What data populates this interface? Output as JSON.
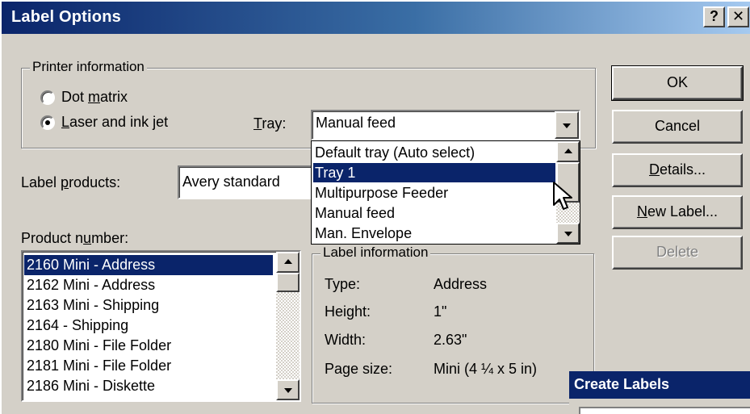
{
  "window": {
    "title": "Label Options",
    "help_glyph": "?",
    "close_glyph": "✕"
  },
  "printer_info": {
    "group_label": "Printer information",
    "dot_matrix": {
      "pre": "Dot ",
      "key": "m",
      "post": "atrix",
      "checked": false
    },
    "laser": {
      "pre": "",
      "key": "L",
      "post": "aser and ink jet",
      "checked": true
    },
    "tray_label": {
      "pre": "",
      "key": "T",
      "post": "ray:"
    },
    "tray_value": "Manual feed"
  },
  "tray_dropdown": {
    "options": [
      "Default tray (Auto select)",
      "Tray 1",
      "Multipurpose Feeder",
      "Manual feed",
      "Man. Envelope"
    ],
    "selected_index": 1
  },
  "label_products": {
    "label": {
      "pre": "Label ",
      "key": "p",
      "post": "roducts:"
    },
    "value": "Avery standard"
  },
  "product_number": {
    "label": {
      "pre": "Product n",
      "key": "u",
      "post": "mber:"
    },
    "items": [
      "2160 Mini - Address",
      "2162 Mini - Address",
      "2163 Mini - Shipping",
      "2164 - Shipping",
      "2180 Mini - File Folder",
      "2181 Mini - File Folder",
      "2186 Mini - Diskette"
    ],
    "selected_index": 0
  },
  "label_info": {
    "group_label": "Label information",
    "rows": [
      {
        "key": "Type:",
        "value": "Address"
      },
      {
        "key": "Height:",
        "value": "1\""
      },
      {
        "key": "Width:",
        "value": "2.63\""
      },
      {
        "key": "Page size:",
        "value": "Mini (4 ¼ x 5 in)"
      }
    ]
  },
  "buttons": {
    "ok": "OK",
    "cancel": "Cancel",
    "details": {
      "pre": "",
      "key": "D",
      "post": "etails..."
    },
    "new_label": {
      "pre": "",
      "key": "N",
      "post": "ew Label..."
    },
    "delete": "Delete"
  },
  "sub_dialog": {
    "title": "Create Labels"
  },
  "colors": {
    "face": "#d4d0c8",
    "title_blue": "#0a246a",
    "selection": "#0a246a"
  }
}
